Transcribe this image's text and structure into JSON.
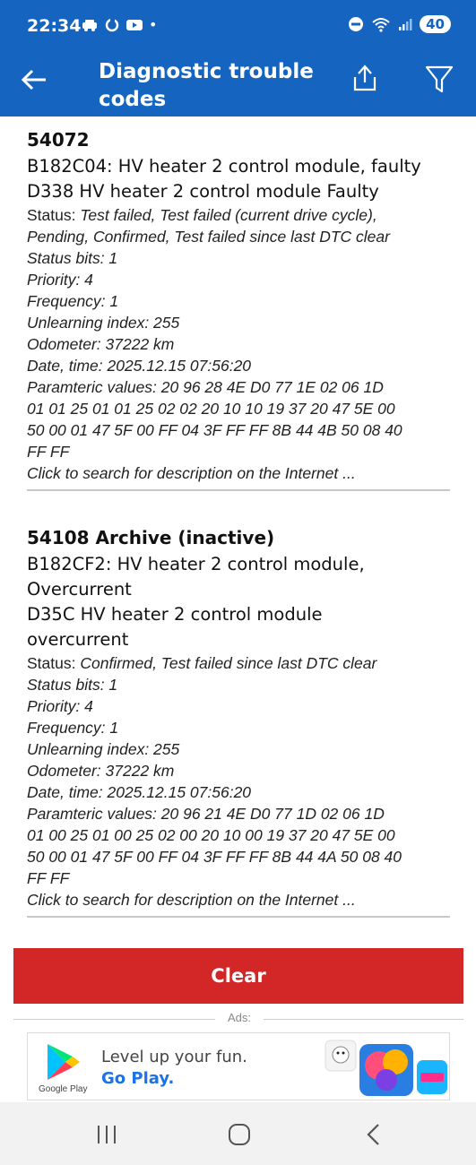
{
  "status_bar": {
    "time": "22:34",
    "battery": "40",
    "left_icons": [
      "car-icon",
      "sync-icon",
      "youtube-icon",
      "dot-icon"
    ],
    "right_icons": [
      "dnd-icon",
      "wifi-icon",
      "signal-icon"
    ]
  },
  "app_bar": {
    "title": "Diagnostic trouble codes",
    "accent_color": "#1565c0"
  },
  "dtc_list": [
    {
      "code": "54072",
      "desc_lines": [
        "B182C04: HV heater 2 control module, faulty",
        "D338 HV heater 2 control module Faulty"
      ],
      "status_label": "Status: ",
      "status_lines": [
        "Test failed, Test failed (current drive cycle),",
        "Pending, Confirmed, Test failed since last DTC clear"
      ],
      "fields": [
        "Status bits: 1",
        "Priority: 4",
        "Frequency: 1",
        "Unlearning index: 255",
        "Odometer: 37222 km",
        "Date, time: 2025.12.15 07:56:20"
      ],
      "param_lines": [
        "Paramteric values:  20 96 28 4E D0 77 1E 02 06 1D",
        "01 01 25 01 01 25 02 02 20 10 10 19 37 20 47 5E 00",
        "50 00 01 47 5F 00 FF 04 3F FF FF 8B 44 4B 50 08 40",
        "FF FF"
      ],
      "search_link": "Click to search for description on the Internet ..."
    },
    {
      "code": "54108 Archive (inactive)",
      "desc_lines": [
        "B182CF2: HV heater 2 control module,",
        "Overcurrent",
        "D35C HV heater 2 control module",
        "overcurrent"
      ],
      "status_label": "Status: ",
      "status_lines": [
        "Confirmed, Test failed since last DTC clear"
      ],
      "fields": [
        "Status bits: 1",
        "Priority: 4",
        "Frequency: 1",
        "Unlearning index: 255",
        "Odometer: 37222 km",
        "Date, time: 2025.12.15 07:56:20"
      ],
      "param_lines": [
        "Paramteric values:  20 96 21 4E D0 77 1D 02 06 1D",
        "01 00 25 01 00 25 02 00 20 10 00 19 37 20 47 5E 00",
        "50 00 01 47 5F 00 FF 04 3F FF FF 8B 44 4A 50 08 40",
        "FF FF"
      ],
      "search_link": "Click to search for description on the Internet ..."
    }
  ],
  "clear_button": {
    "label": "Clear",
    "color": "#d32626"
  },
  "ads": {
    "label": "Ads:",
    "banner": {
      "store_name": "Google Play",
      "headline": "Level up your fun.",
      "cta": "Go Play."
    }
  },
  "nav_bar": {
    "buttons": [
      "recents-icon",
      "home-icon",
      "back-nav-icon"
    ]
  }
}
